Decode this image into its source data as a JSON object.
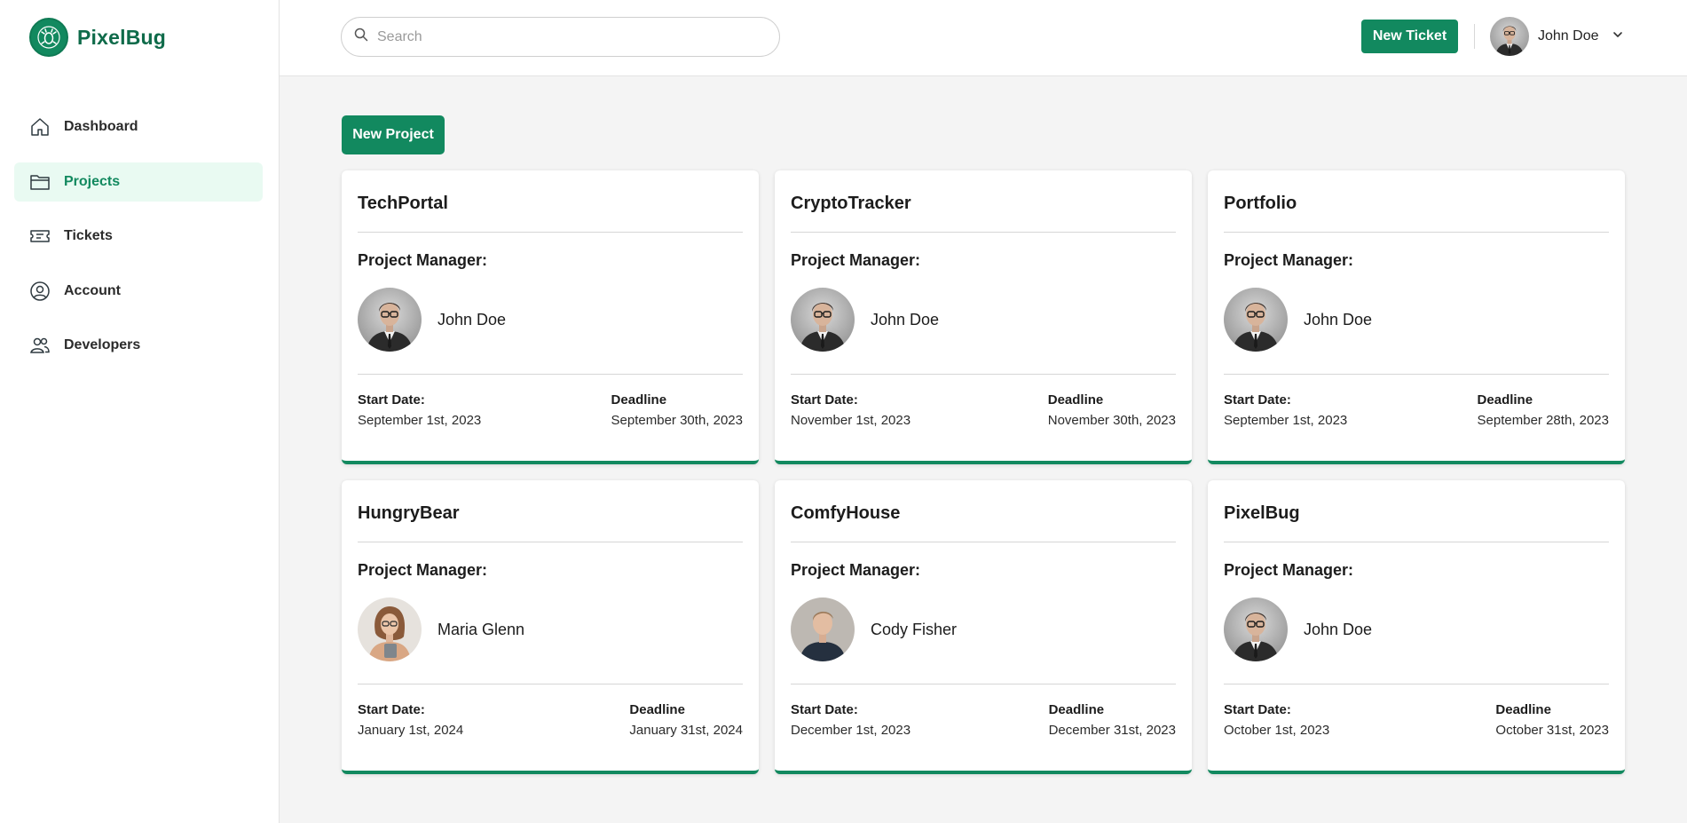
{
  "brand": {
    "name": "PixelBug",
    "accent": "#12895f"
  },
  "sidebar": {
    "items": [
      {
        "label": "Dashboard",
        "icon": "home-icon",
        "active": false
      },
      {
        "label": "Projects",
        "icon": "folder-icon",
        "active": true
      },
      {
        "label": "Tickets",
        "icon": "ticket-icon",
        "active": false
      },
      {
        "label": "Account",
        "icon": "user-circle-icon",
        "active": false
      },
      {
        "label": "Developers",
        "icon": "users-icon",
        "active": false
      }
    ]
  },
  "header": {
    "search_placeholder": "Search",
    "new_ticket_label": "New Ticket",
    "user_name": "John Doe"
  },
  "main": {
    "new_project_label": "New Project",
    "project_manager_label": "Project Manager:",
    "start_date_label": "Start Date:",
    "deadline_label": "Deadline",
    "projects": [
      {
        "title": "TechPortal",
        "manager": "John Doe",
        "start": "September 1st, 2023",
        "deadline": "September 30th, 2023"
      },
      {
        "title": "CryptoTracker",
        "manager": "John Doe",
        "start": "November 1st, 2023",
        "deadline": "November 30th, 2023"
      },
      {
        "title": "Portfolio",
        "manager": "John Doe",
        "start": "September 1st, 2023",
        "deadline": "September 28th, 2023"
      },
      {
        "title": "HungryBear",
        "manager": "Maria Glenn",
        "start": "January 1st, 2024",
        "deadline": "January 31st, 2024"
      },
      {
        "title": "ComfyHouse",
        "manager": "Cody Fisher",
        "start": "December 1st, 2023",
        "deadline": "December 31st, 2023"
      },
      {
        "title": "PixelBug",
        "manager": "John Doe",
        "start": "October 1st, 2023",
        "deadline": "October 31st, 2023"
      }
    ]
  }
}
